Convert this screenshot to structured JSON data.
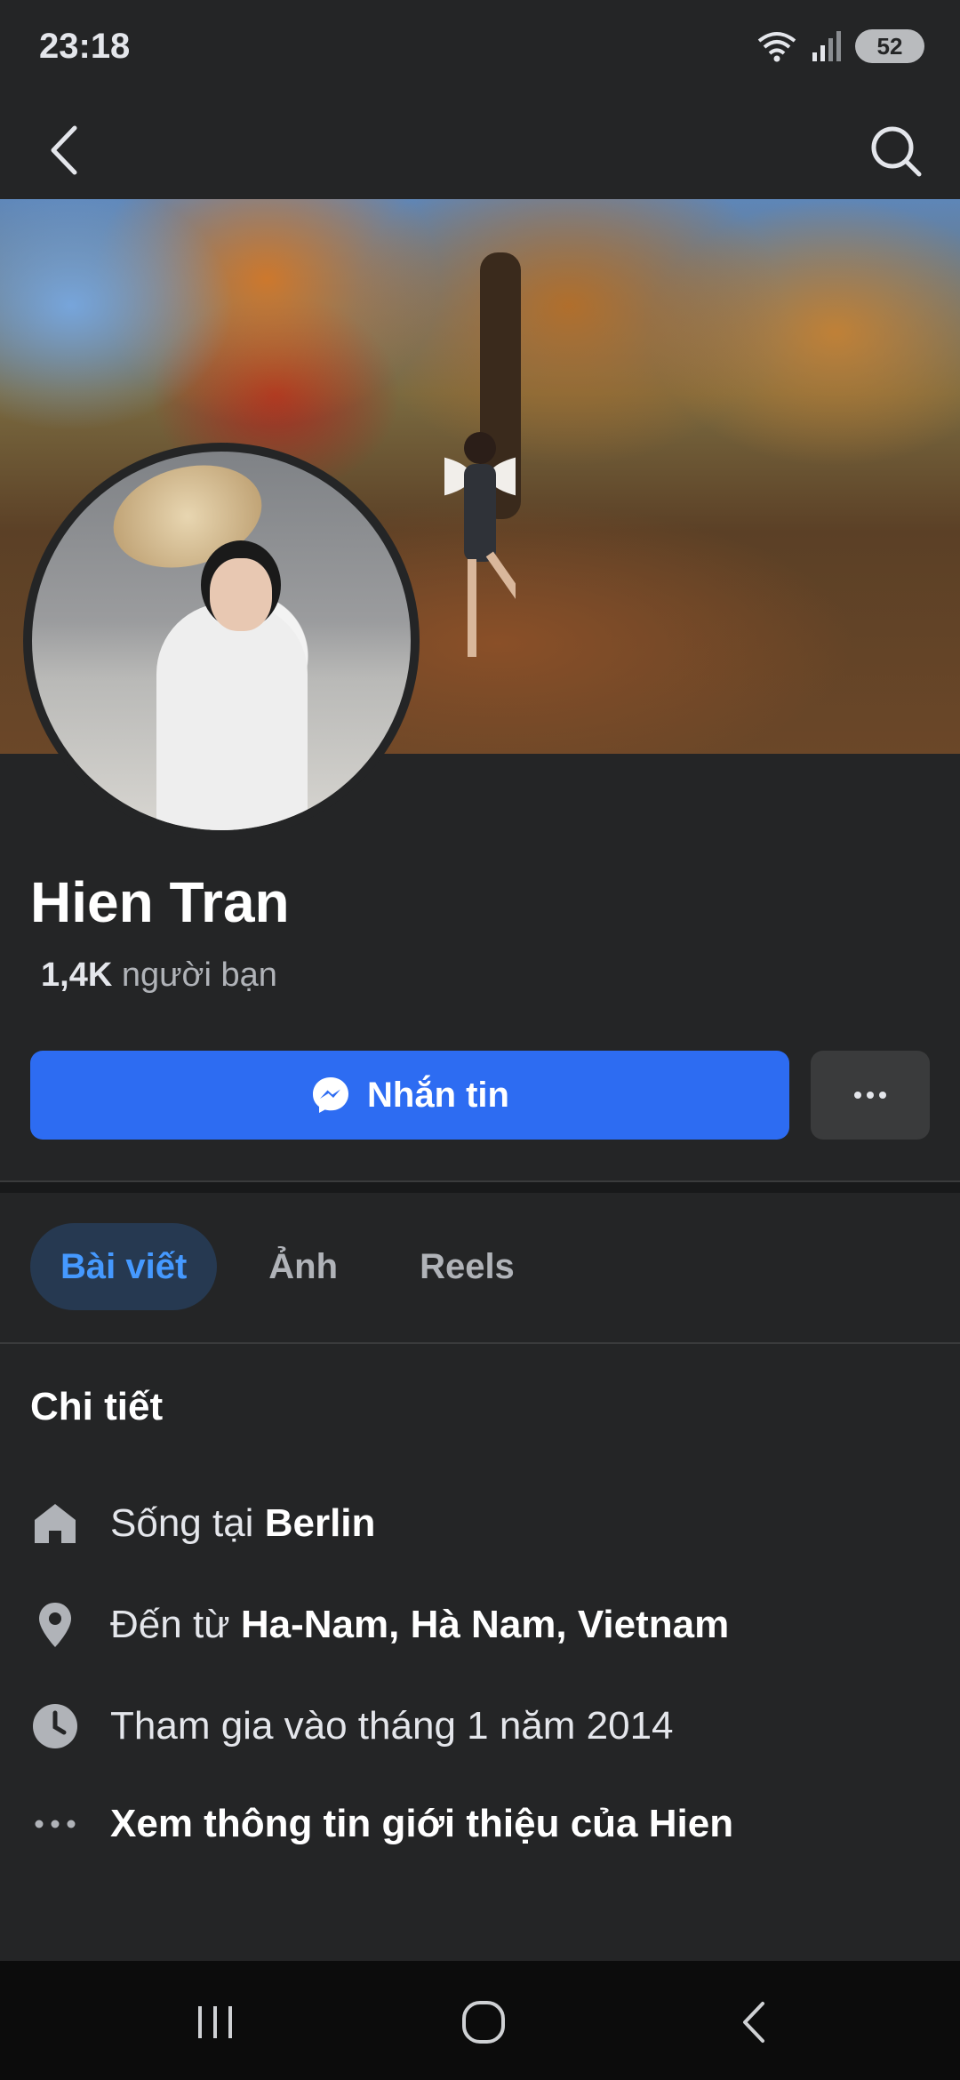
{
  "status_bar": {
    "time": "23:18",
    "battery": "52"
  },
  "profile": {
    "name": "Hien Tran",
    "friends_count": "1,4K",
    "friends_label": "người bạn"
  },
  "actions": {
    "message_label": "Nhắn tin"
  },
  "tabs": [
    {
      "label": "Bài viết",
      "active": true
    },
    {
      "label": "Ảnh",
      "active": false
    },
    {
      "label": "Reels",
      "active": false
    }
  ],
  "details": {
    "title": "Chi tiết",
    "lives_in_prefix": "Sống tại",
    "lives_in_value": "Berlin",
    "from_prefix": "Đến từ",
    "from_value": "Ha-Nam, Hà Nam, Vietnam",
    "joined": "Tham gia vào tháng 1 năm 2014",
    "see_about": "Xem thông tin giới thiệu của Hien"
  },
  "colors": {
    "accent": "#2d6cf2",
    "background": "#242526",
    "tab_active_bg": "#263951",
    "tab_active_text": "#4599ff"
  },
  "icons": [
    "back-icon",
    "search-icon",
    "messenger-icon",
    "more-dots-icon",
    "home-icon",
    "location-pin-icon",
    "clock-icon",
    "ellipsis-icon",
    "recent-apps-icon",
    "home-nav-icon",
    "back-nav-icon",
    "wifi-icon",
    "signal-icon",
    "battery-icon"
  ]
}
